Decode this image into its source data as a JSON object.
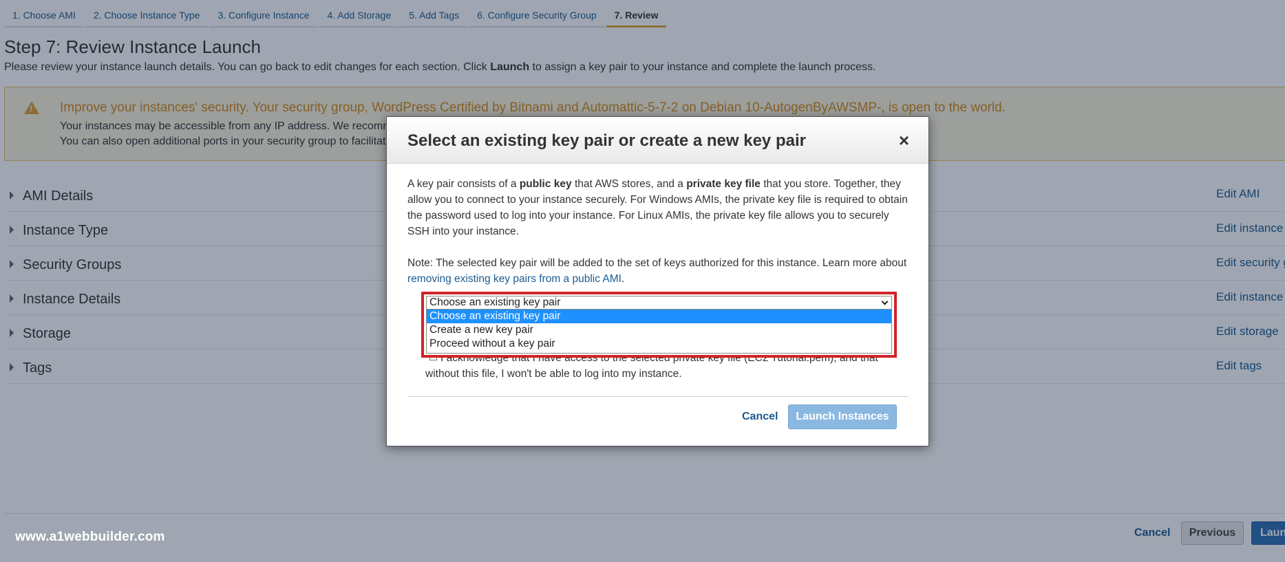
{
  "tabs": [
    {
      "label": "1. Choose AMI"
    },
    {
      "label": "2. Choose Instance Type"
    },
    {
      "label": "3. Configure Instance"
    },
    {
      "label": "4. Add Storage"
    },
    {
      "label": "5. Add Tags"
    },
    {
      "label": "6. Configure Security Group"
    },
    {
      "label": "7. Review"
    }
  ],
  "page": {
    "title": "Step 7: Review Instance Launch",
    "desc_before": "Please review your instance launch details. You can go back to edit changes for each section. Click ",
    "desc_bold": "Launch",
    "desc_after": " to assign a key pair to your instance and complete the launch process."
  },
  "warning": {
    "title": "Improve your instances' security. Your security group, WordPress Certified by Bitnami and Automattic-5-7-2 on Debian 10-AutogenByAWSMP-, is open to the world.",
    "line1": "Your instances may be accessible from any IP address. We recomm",
    "line2": "You can also open additional ports in your security group to facilitate"
  },
  "sections": [
    {
      "label": "AMI Details",
      "edit": "Edit AMI"
    },
    {
      "label": "Instance Type",
      "edit": "Edit instance type"
    },
    {
      "label": "Security Groups",
      "edit": "Edit security groups"
    },
    {
      "label": "Instance Details",
      "edit": "Edit instance details"
    },
    {
      "label": "Storage",
      "edit": "Edit storage"
    },
    {
      "label": "Tags",
      "edit": "Edit tags"
    }
  ],
  "footer": {
    "watermark": "www.a1webbuilder.com",
    "cancel": "Cancel",
    "previous": "Previous",
    "launch": "Launch"
  },
  "modal": {
    "title": "Select an existing key pair or create a new key pair",
    "close": "×",
    "p1_a": "A key pair consists of a ",
    "p1_b": "public key",
    "p1_c": " that AWS stores, and a ",
    "p1_d": "private key file",
    "p1_e": " that you store. Together, they allow you to connect to your instance securely. For Windows AMIs, the private key file is required to obtain the password used to log into your instance. For Linux AMIs, the private key file allows you to securely SSH into your instance.",
    "note_a": "Note: The selected key pair will be added to the set of keys authorized for this instance. Learn more about ",
    "note_link": "removing existing key pairs from a public AMI",
    "note_b": ".",
    "select_value": "Choose an existing key pair",
    "options": [
      {
        "label": "Choose an existing key pair"
      },
      {
        "label": "Create a new key pair"
      },
      {
        "label": "Proceed without a key pair"
      }
    ],
    "ack": "I acknowledge that I have access to the selected private key file (EC2 Tutorial.pem), and that without this file, I won't be able to log into my instance.",
    "cancel": "Cancel",
    "launch": "Launch Instances"
  }
}
